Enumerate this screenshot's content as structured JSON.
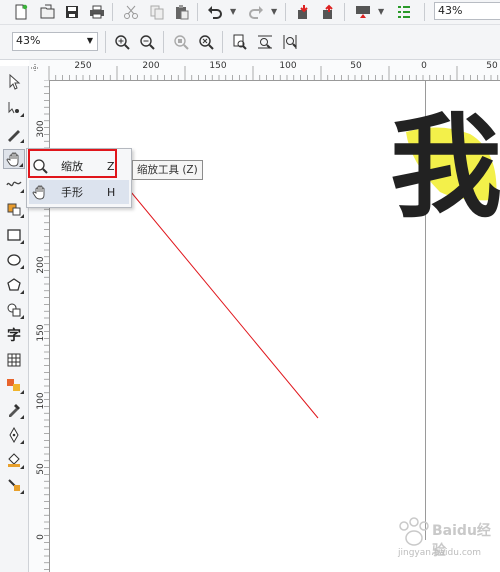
{
  "toolbar_top": {
    "zoom_value": "43%",
    "icons": [
      "new-document-icon",
      "open-folder-icon",
      "save-icon",
      "print-icon",
      "cut-icon",
      "copy-icon",
      "paste-icon",
      "undo-icon",
      "redo-icon",
      "import-icon",
      "export-icon",
      "publish-icon",
      "options-icon"
    ]
  },
  "toolbar_zoom": {
    "zoom_value": "43%",
    "icons": [
      "zoom-in-icon",
      "zoom-out-icon",
      "zoom-selected-icon",
      "zoom-all-icon",
      "zoom-page-icon",
      "zoom-width-icon",
      "zoom-height-icon"
    ]
  },
  "ruler": {
    "horizontal_labels": [
      "250",
      "200",
      "150",
      "100",
      "50",
      "0",
      "50"
    ],
    "vertical_labels": [
      "300",
      "250",
      "200",
      "150",
      "100",
      "50",
      "0"
    ]
  },
  "flyout": {
    "items": [
      {
        "label": "缩放",
        "key": "Z",
        "icon": "zoom-icon"
      },
      {
        "label": "手形",
        "key": "H",
        "icon": "hand-icon"
      }
    ]
  },
  "tooltip": {
    "text": "缩放工具 (Z)"
  },
  "canvas": {
    "character": "我"
  },
  "colors": {
    "highlight_red": "#e0151b",
    "glow_yellow": "#f3f04a"
  },
  "watermark": {
    "brand": "Baidu经验",
    "url": "jingyan.baidu.com"
  }
}
